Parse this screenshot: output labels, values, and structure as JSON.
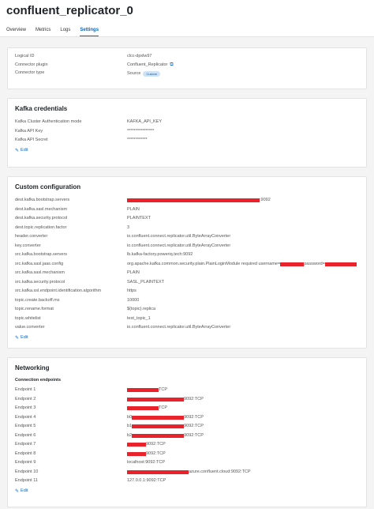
{
  "page_title": "confluent_replicator_0",
  "tabs": [
    "Overview",
    "Metrics",
    "Logs",
    "Settings"
  ],
  "summary": {
    "rows": [
      {
        "key": "Logical ID",
        "value": "clcc-dpxlw97"
      },
      {
        "key": "Connector plugin",
        "value": "Confluent_Replicator"
      },
      {
        "key": "Connector type",
        "value": "Source"
      }
    ],
    "badge": "Custom"
  },
  "kafka_credentials": {
    "title": "Kafka credentials",
    "rows": [
      {
        "key": "Kafka Cluster Authentication mode",
        "value": "KAFKA_API_KEY"
      },
      {
        "key": "Kafka API Key",
        "value": "****************"
      },
      {
        "key": "Kafka API Secret",
        "value": "************"
      }
    ],
    "edit": "Edit"
  },
  "custom_configuration": {
    "title": "Custom configuration",
    "rows": [
      {
        "key": "dest.kafka.bootstrap.servers",
        "value": ":9092"
      },
      {
        "key": "dest.kafka.sasl.mechanism",
        "value": "PLAIN"
      },
      {
        "key": "dest.kafka.security.protocol",
        "value": "PLAINTEXT"
      },
      {
        "key": "dest.topic.replication.factor",
        "value": "3"
      },
      {
        "key": "header.converter",
        "value": "io.confluent.connect.replicator.util.ByteArrayConverter"
      },
      {
        "key": "key.converter",
        "value": "io.confluent.connect.replicator.util.ByteArrayConverter"
      },
      {
        "key": "src.kafka.bootstrap.servers",
        "value": "lb.kafka-factory.poweriq.tech:9092"
      },
      {
        "key": "src.kafka.sasl.jaas.config",
        "value": "org.apache.kafka.common.security.plain.PlainLoginModule required username=",
        "value2": " password="
      },
      {
        "key": "src.kafka.sasl.mechanism",
        "value": "PLAIN"
      },
      {
        "key": "src.kafka.security.protocol",
        "value": "SASL_PLAINTEXT"
      },
      {
        "key": "src.kafka.ssl.endpoint.identification.algorithm",
        "value": "https"
      },
      {
        "key": "topic.create.backoff.ms",
        "value": "10000"
      },
      {
        "key": "topic.rename.format",
        "value": "${topic}.replica"
      },
      {
        "key": "topic.whitelist",
        "value": "test_topic_1"
      },
      {
        "key": "value.converter",
        "value": "io.confluent.connect.replicator.util.ByteArrayConverter"
      }
    ],
    "edit": "Edit"
  },
  "networking": {
    "title": "Networking",
    "subtitle": "Connection endpoints",
    "rows": [
      {
        "key": "Endpoint 1",
        "prefix": "",
        "value": "TCP"
      },
      {
        "key": "Endpoint 2",
        "prefix": "",
        "value": "9092:TCP"
      },
      {
        "key": "Endpoint 3",
        "prefix": "",
        "value": "TCP"
      },
      {
        "key": "Endpoint 4",
        "prefix": "b0",
        "value": "9092:TCP"
      },
      {
        "key": "Endpoint 5",
        "prefix": "b1",
        "value": "9092:TCP"
      },
      {
        "key": "Endpoint 6",
        "prefix": "b2",
        "value": "9092:TCP"
      },
      {
        "key": "Endpoint 7",
        "prefix": "",
        "value": "9092:TCP"
      },
      {
        "key": "Endpoint 8",
        "prefix": "",
        "value": "9092:TCP"
      },
      {
        "key": "Endpoint 9",
        "prefix": "",
        "value": "localhost:9092:TCP"
      },
      {
        "key": "Endpoint 10",
        "prefix": "",
        "value": "azure.confluent.cloud:9092:TCP"
      },
      {
        "key": "Endpoint 11",
        "prefix": "",
        "value": "127.0.0.1:9092:TCP"
      }
    ],
    "edit": "Edit"
  }
}
